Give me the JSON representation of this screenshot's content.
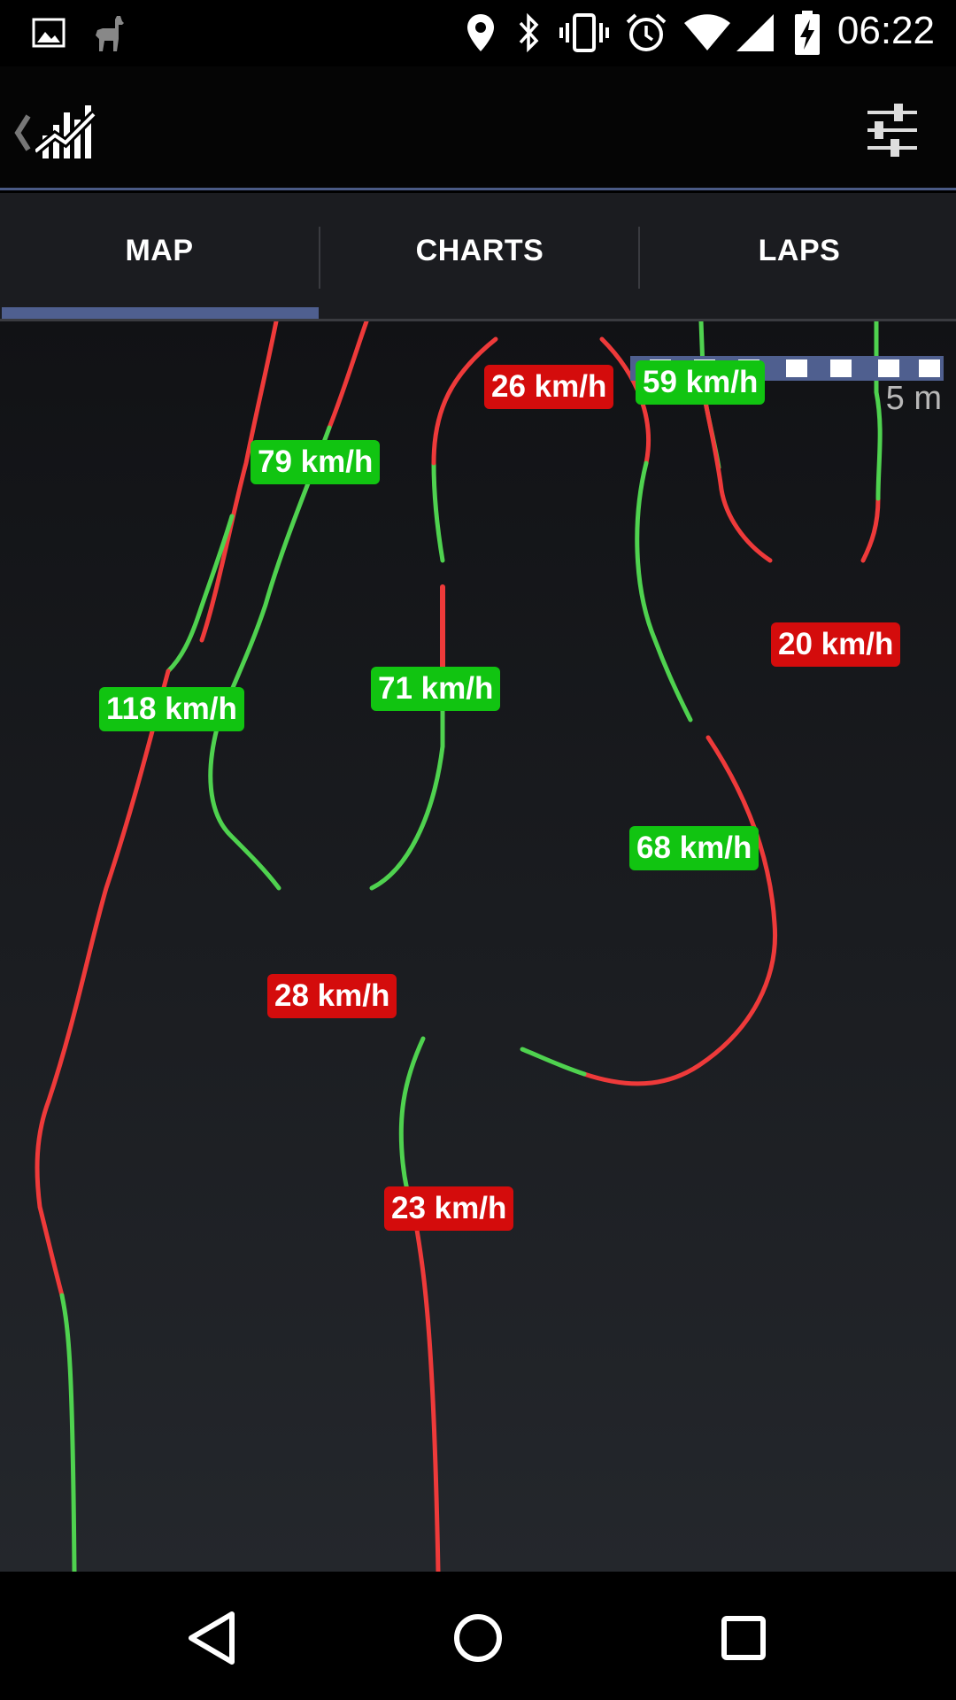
{
  "status_bar": {
    "time": "06:22",
    "icons": [
      "image-icon",
      "llama-icon",
      "location-icon",
      "bluetooth-icon",
      "vibrate-icon",
      "alarm-icon",
      "wifi-icon",
      "signal-icon",
      "battery-charging-icon"
    ]
  },
  "action_bar": {
    "up_icon": "back-chevron-icon",
    "app_icon": "speed-chart-icon",
    "settings_icon": "sliders-icon"
  },
  "tabs": [
    {
      "label": "MAP",
      "selected": true
    },
    {
      "label": "CHARTS",
      "selected": false
    },
    {
      "label": "LAPS",
      "selected": false
    }
  ],
  "map": {
    "scale_label": "5 m",
    "colors": {
      "fast": "#4fd24f",
      "slow": "#ee3a3a",
      "label_green": "#11c411",
      "label_red": "#d40c0c"
    },
    "speed_labels": [
      {
        "text": "26 km/h",
        "kind": "slow"
      },
      {
        "text": "59 km/h",
        "kind": "fast"
      },
      {
        "text": "79 km/h",
        "kind": "fast"
      },
      {
        "text": "20 km/h",
        "kind": "slow"
      },
      {
        "text": "118 km/h",
        "kind": "fast"
      },
      {
        "text": "71 km/h",
        "kind": "fast"
      },
      {
        "text": "68 km/h",
        "kind": "fast"
      },
      {
        "text": "28 km/h",
        "kind": "slow"
      },
      {
        "text": "23 km/h",
        "kind": "slow"
      }
    ]
  },
  "nav_bar": {
    "icons": [
      "back-triangle-icon",
      "home-circle-icon",
      "recents-square-icon"
    ]
  }
}
